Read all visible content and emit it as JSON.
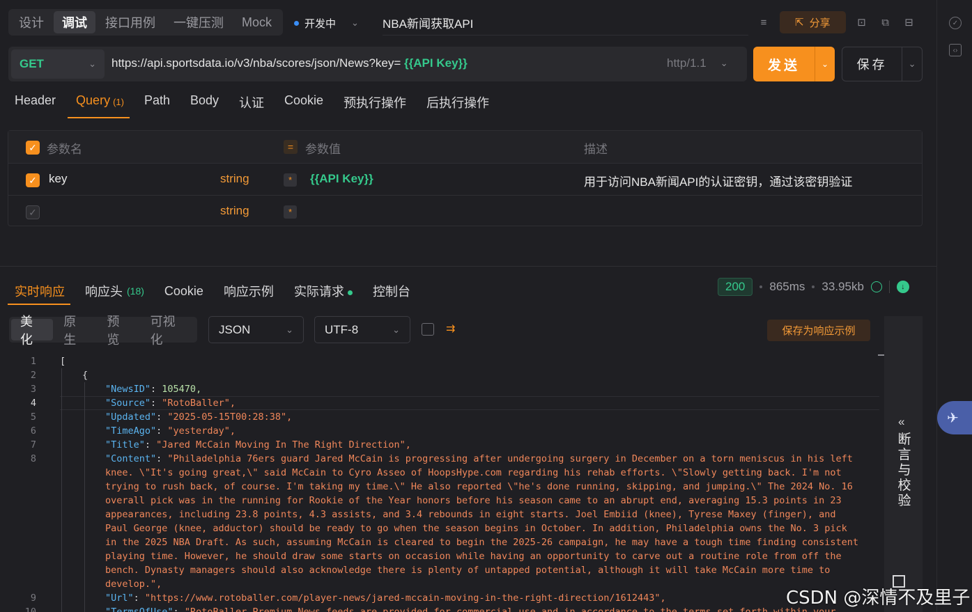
{
  "header": {
    "mode_tabs": [
      "设计",
      "调试",
      "接口用例",
      "一键压测",
      "Mock"
    ],
    "active_mode": 1,
    "status": "开发中",
    "api_name": "NBA新闻获取API",
    "share_label": "分享"
  },
  "request": {
    "method": "GET",
    "url_prefix": "https://api.sportsdata.io/v3/nba/scores/json/News?key=",
    "url_variable": "{{API Key}}",
    "protocol": "http/1.1",
    "send_label": "发送",
    "save_label": "保存"
  },
  "request_tabs": {
    "items": [
      "Header",
      "Query",
      "Path",
      "Body",
      "认证",
      "Cookie",
      "预执行操作",
      "后执行操作"
    ],
    "query_count": "(1)",
    "active": "Query"
  },
  "params": {
    "headers": {
      "name": "参数名",
      "value": "参数值",
      "desc": "描述",
      "eq": "="
    },
    "rows": [
      {
        "name": "key",
        "type": "string",
        "required": "*",
        "value": "{{API Key}}",
        "desc": "用于访问NBA新闻API的认证密钥，通过该密钥验证",
        "checked": true
      },
      {
        "name": "",
        "type": "string",
        "required": "*",
        "value": "",
        "desc": "",
        "checked": false
      }
    ]
  },
  "response": {
    "tabs": [
      "实时响应",
      "响应头",
      "Cookie",
      "响应示例",
      "实际请求",
      "控制台"
    ],
    "header_count": "(18)",
    "status_code": "200",
    "time": "865ms",
    "size": "33.95kb",
    "view_tabs": [
      "美化",
      "原生",
      "预览",
      "可视化"
    ],
    "format": "JSON",
    "encoding": "UTF-8",
    "save_example_label": "保存为响应示例",
    "assert_label": "断言与校验",
    "assert_chevron": "«"
  },
  "code": {
    "lines": [
      {
        "n": "1",
        "indent": 0,
        "text": "["
      },
      {
        "n": "2",
        "indent": 1,
        "text": "{"
      },
      {
        "n": "3",
        "indent": 2,
        "key": "\"NewsID\"",
        "num": "105470,"
      },
      {
        "n": "4",
        "indent": 2,
        "key": "\"Source\"",
        "str": "\"RotoBaller\","
      },
      {
        "n": "5",
        "indent": 2,
        "key": "\"Updated\"",
        "str": "\"2025-05-15T00:28:38\","
      },
      {
        "n": "6",
        "indent": 2,
        "key": "\"TimeAgo\"",
        "str": "\"yesterday\","
      },
      {
        "n": "7",
        "indent": 2,
        "key": "\"Title\"",
        "str": "\"Jared McCain Moving In The Right Direction\","
      },
      {
        "n": "8",
        "indent": 2,
        "key": "\"Content\"",
        "str": "\"Philadelphia 76ers guard Jared McCain is progressing after undergoing surgery in December on a torn meniscus in his left"
      },
      {
        "n": "",
        "indent": 2,
        "str": "knee. \\\"It's going great,\\\" said McCain to Cyro Asseo of HoopsHype.com regarding his rehab efforts. \\\"Slowly getting back. I'm not"
      },
      {
        "n": "",
        "indent": 2,
        "str": "trying to rush back, of course. I'm taking my time.\\\" He also reported \\\"he's done running, skipping, and jumping.\\\" The 2024 No. 16"
      },
      {
        "n": "",
        "indent": 2,
        "str": "overall pick was in the running for Rookie of the Year honors before his season came to an abrupt end, averaging 15.3 points in 23"
      },
      {
        "n": "",
        "indent": 2,
        "str": "appearances, including 23.8 points, 4.3 assists, and 3.4 rebounds in eight starts. Joel Embiid (knee), Tyrese Maxey (finger), and"
      },
      {
        "n": "",
        "indent": 2,
        "str": "Paul George (knee, adductor) should be ready to go when the season begins in October. In addition, Philadelphia owns the No. 3 pick"
      },
      {
        "n": "",
        "indent": 2,
        "str": "in the 2025 NBA Draft. As such, assuming McCain is cleared to begin the 2025-26 campaign, he may have a tough time finding consistent"
      },
      {
        "n": "",
        "indent": 2,
        "str": "playing time. However, he should draw some starts on occasion while having an opportunity to carve out a routine role from off the"
      },
      {
        "n": "",
        "indent": 2,
        "str": "bench. Dynasty managers should also acknowledge there is plenty of untapped potential, although it will take McCain more time to"
      },
      {
        "n": "",
        "indent": 2,
        "str": "develop.\","
      },
      {
        "n": "9",
        "indent": 2,
        "key": "\"Url\"",
        "str": "\"https://www.rotoballer.com/player-news/jared-mccain-moving-in-the-right-direction/1612443\","
      },
      {
        "n": "10",
        "indent": 2,
        "key": "\"TermsOfUse\"",
        "str": "\"RotoBaller Premium News feeds are provided for commercial use and in accordance to the terms set forth within your"
      }
    ]
  },
  "watermark": "CSDN @深情不及里子",
  "colors": {
    "accent": "#f7901e",
    "green": "#35c98c",
    "blue": "#3a8ef6",
    "background": "#1f1f23"
  }
}
